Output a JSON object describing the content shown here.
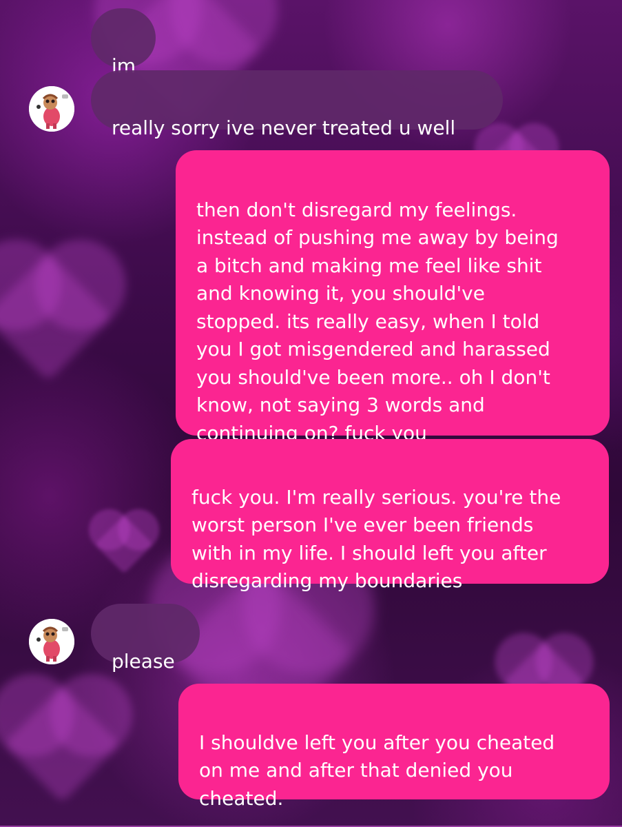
{
  "conversation": {
    "messages": [
      {
        "sender": "them",
        "text": "im"
      },
      {
        "sender": "them",
        "text": "really sorry ive never treated u well"
      },
      {
        "sender": "me",
        "text": "then don't disregard my feelings.\ninstead of pushing me away by being\na bitch and making me feel like shit\nand knowing it, you should've\nstopped. its really easy, when I told\nyou I got misgendered and harassed\nyou should've been more.. oh I don't\nknow, not saying 3 words and\ncontinuing on? fuck you"
      },
      {
        "sender": "me",
        "text": "fuck you. I'm really serious. you're the\nworst person I've ever been friends\nwith in my life. I should left you after\ndisregarding my boundaries"
      },
      {
        "sender": "them",
        "text": "please"
      },
      {
        "sender": "me",
        "text": "I shouldve left you after you cheated\non me and after that denied you\ncheated."
      }
    ]
  },
  "theme": {
    "outgoing_bubble": "#fb2591",
    "incoming_bubble": "#5f2869",
    "background": "#3a0a45",
    "text": "#ffffff"
  },
  "icons": {
    "avatar": "avatar-icon"
  }
}
